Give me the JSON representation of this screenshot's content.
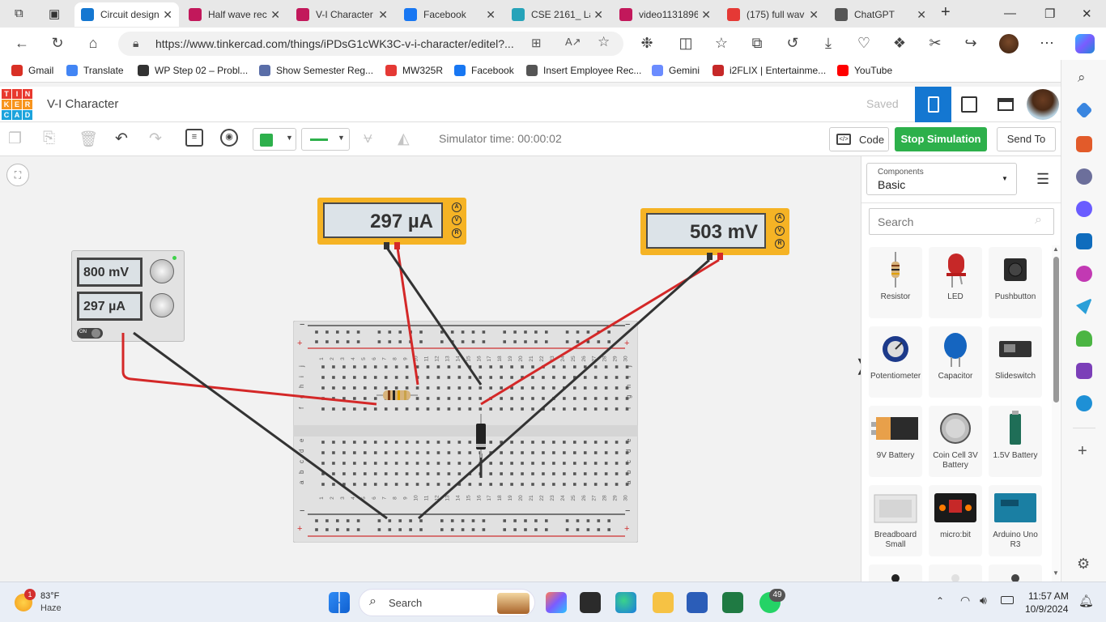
{
  "browser": {
    "tabs": [
      {
        "label": "Circuit design",
        "color": "#1477d1",
        "active": true
      },
      {
        "label": "Half wave rec",
        "color": "#c2185b"
      },
      {
        "label": "V-I Character",
        "color": "#c2185b"
      },
      {
        "label": "Facebook",
        "color": "#1877f2"
      },
      {
        "label": "CSE 2161_ Lal",
        "color": "#26a3b9"
      },
      {
        "label": "video1131896",
        "color": "#c2185b"
      },
      {
        "label": "(175) full wav",
        "color": "#e53935"
      },
      {
        "label": "ChatGPT",
        "color": "#555555"
      }
    ],
    "url": "https://www.tinkercad.com/things/iPDsG1cWK3C-v-i-character/editel?...",
    "bookmarks": [
      {
        "label": "Gmail",
        "color": "#d93025"
      },
      {
        "label": "Translate",
        "color": "#4285f4"
      },
      {
        "label": "WP Step 02 – Probl...",
        "color": "#333333"
      },
      {
        "label": "Show Semester Reg...",
        "color": "#5a6ea8"
      },
      {
        "label": "MW325R",
        "color": "#e53935"
      },
      {
        "label": "Facebook",
        "color": "#1877f2"
      },
      {
        "label": "Insert Employee Rec...",
        "color": "#555555"
      },
      {
        "label": "Gemini",
        "color": "#6b8cff"
      },
      {
        "label": "i2FLIX | Entertainme...",
        "color": "#c62828"
      },
      {
        "label": "YouTube",
        "color": "#ff0000"
      }
    ]
  },
  "tinkercad": {
    "logo_letters": [
      "T",
      "I",
      "N",
      "K",
      "E",
      "R",
      "C",
      "A",
      "D"
    ],
    "project_title": "V-I Character",
    "saved_label": "Saved",
    "simulator_time": "Simulator time: 00:00:02",
    "code_label": "Code",
    "stop_label": "Stop Simulation",
    "send_label": "Send To",
    "accent": "#1477d1",
    "stop_color": "#2db04b"
  },
  "circuit": {
    "multimeter_current": "297 µA",
    "multimeter_voltage": "503 mV",
    "supply_voltage": "800 mV",
    "supply_current": "297 µA",
    "meter_modes": [
      "A",
      "V",
      "R"
    ],
    "supply_on_label": "ON",
    "column_numbers": [
      "1",
      "2",
      "3",
      "4",
      "5",
      "6",
      "7",
      "8",
      "9",
      "10",
      "11",
      "12",
      "13",
      "14",
      "15",
      "16",
      "17",
      "18",
      "19",
      "20",
      "21",
      "22",
      "23",
      "24",
      "25",
      "26",
      "27",
      "28",
      "29",
      "30"
    ],
    "row_letters_top": [
      "j",
      "i",
      "h",
      "g",
      "f"
    ],
    "row_letters_bottom": [
      "e",
      "d",
      "c",
      "b",
      "a"
    ]
  },
  "panel": {
    "category_caption": "Components",
    "category_value": "Basic",
    "search_placeholder": "Search",
    "components": [
      {
        "label": "Resistor",
        "icon": "resistor-icon"
      },
      {
        "label": "LED",
        "icon": "led-icon"
      },
      {
        "label": "Pushbutton",
        "icon": "pushbutton-icon"
      },
      {
        "label": "Potentiometer",
        "icon": "potentiometer-icon"
      },
      {
        "label": "Capacitor",
        "icon": "capacitor-icon"
      },
      {
        "label": "Slideswitch",
        "icon": "slideswitch-icon"
      },
      {
        "label": "9V Battery",
        "icon": "battery-9v-icon"
      },
      {
        "label": "Coin Cell 3V Battery",
        "icon": "coin-cell-icon"
      },
      {
        "label": "1.5V Battery",
        "icon": "battery-aa-icon"
      },
      {
        "label": "Breadboard Small",
        "icon": "breadboard-icon"
      },
      {
        "label": "micro:bit",
        "icon": "microbit-icon"
      },
      {
        "label": "Arduino Uno R3",
        "icon": "arduino-icon"
      }
    ]
  },
  "taskbar": {
    "weather_temp": "83°F",
    "weather_cond": "Haze",
    "weather_badge": "1",
    "search_label": "Search",
    "whatsapp_badge": "49",
    "time": "11:57 AM",
    "date": "10/9/2024"
  }
}
